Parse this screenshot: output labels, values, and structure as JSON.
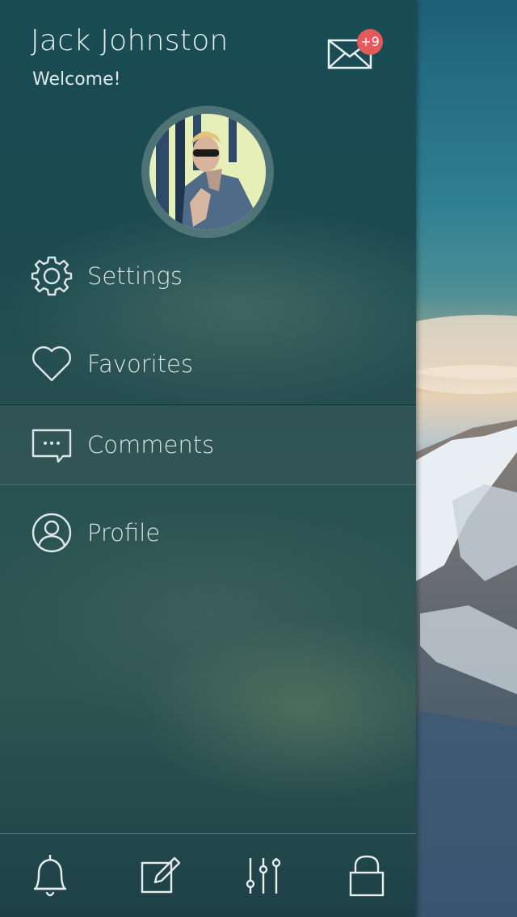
{
  "user": {
    "name": "Jack Johnston",
    "greeting": "Welcome!"
  },
  "notifications": {
    "badge": "+9",
    "icon": "mail-icon"
  },
  "menu": [
    {
      "label": "Settings",
      "icon": "gear-icon"
    },
    {
      "label": "Favorites",
      "icon": "heart-icon"
    },
    {
      "label": "Comments",
      "icon": "comment-icon"
    },
    {
      "label": "Profile",
      "icon": "user-circle-icon"
    }
  ],
  "bottom_bar": [
    {
      "icon": "bell-icon"
    },
    {
      "icon": "compose-icon"
    },
    {
      "icon": "sliders-icon"
    },
    {
      "icon": "lock-icon"
    }
  ],
  "colors": {
    "badge": "#e45a5a",
    "drawer": "#1d4a50",
    "text": "#e8eef0"
  }
}
